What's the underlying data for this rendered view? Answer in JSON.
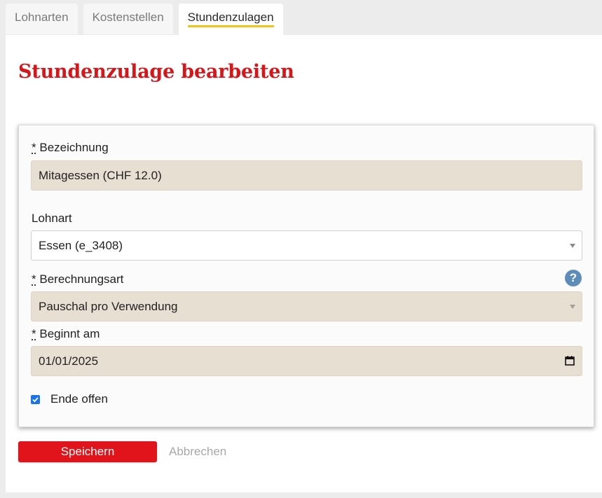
{
  "tabs": [
    {
      "label": "Lohnarten"
    },
    {
      "label": "Kostenstellen"
    },
    {
      "label": "Stundenzulagen"
    }
  ],
  "page_title": "Stundenzulage bearbeiten",
  "form": {
    "required_marker": "*",
    "bezeichnung": {
      "label": "Bezeichnung",
      "value": "Mitagessen (CHF 12.0)"
    },
    "lohnart": {
      "label": "Lohnart",
      "value": "Essen (e_3408)"
    },
    "berechnungsart": {
      "label": "Berechnungsart",
      "value": "Pauschal pro Verwendung",
      "help": "?"
    },
    "beginnt_am": {
      "label": "Beginnt am",
      "value": "01/01/2025"
    },
    "ende_offen": {
      "label": "Ende offen",
      "checked": true
    }
  },
  "actions": {
    "save_label": "Speichern",
    "cancel_label": "Abbrechen"
  },
  "colors": {
    "title": "#d81519",
    "save_button": "#e0141a",
    "active_tab_underline": "#f2c418",
    "field_beige": "#e8dfd3",
    "help_icon": "#5e8cb8",
    "checkbox": "#1a73e8"
  },
  "icons": {
    "select_caret": "chevron-down-icon",
    "help": "help-icon",
    "calendar": "calendar-icon",
    "checkbox": "checkmark-icon"
  }
}
